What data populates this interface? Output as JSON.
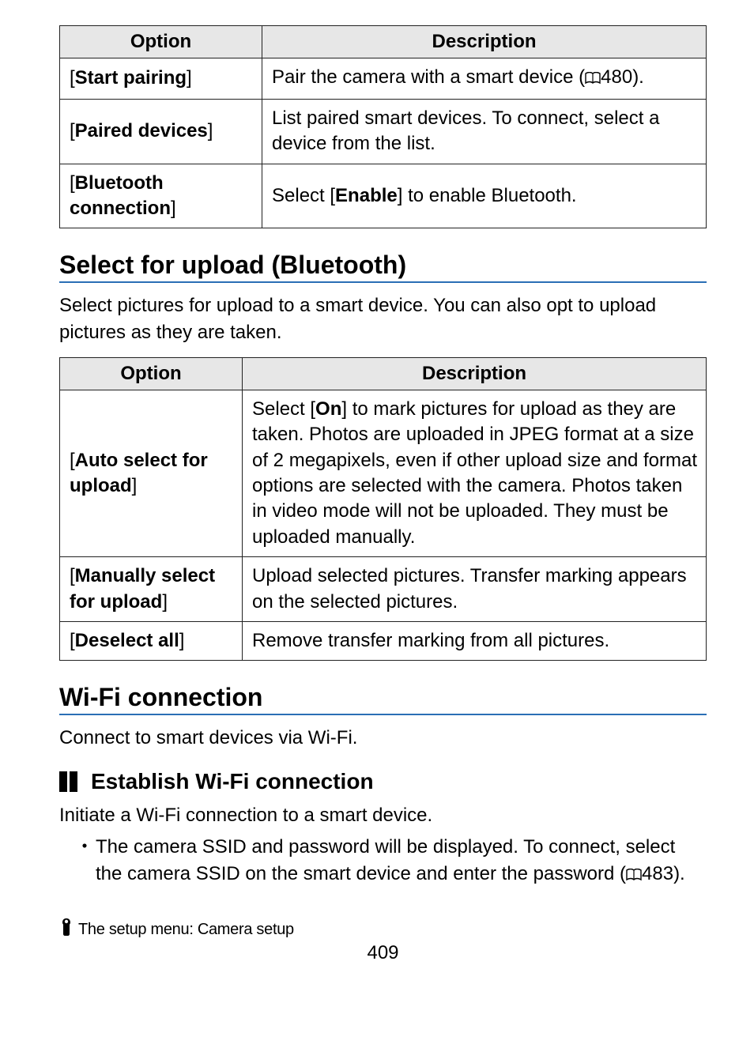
{
  "table1": {
    "headers": {
      "option": "Option",
      "description": "Description"
    },
    "rows": [
      {
        "option_open": "[",
        "option_bold": "Start pairing",
        "option_close": "]",
        "desc_pre": "Pair the camera with a smart device (",
        "desc_ref": "480",
        "desc_post": ")."
      },
      {
        "option_open": "[",
        "option_bold": "Paired devices",
        "option_close": "]",
        "desc": "List paired smart devices. To connect, select a device from the list."
      },
      {
        "option_open": "[",
        "option_bold": "Bluetooth connection",
        "option_close": "]",
        "desc_pre": "Select [",
        "desc_bold": "Enable",
        "desc_post": "] to enable Bluetooth."
      }
    ]
  },
  "section1": {
    "title": "Select for upload (Bluetooth)",
    "lead": "Select pictures for upload to a smart device. You can also opt to upload pictures as they are taken."
  },
  "table2": {
    "headers": {
      "option": "Option",
      "description": "Description"
    },
    "rows": [
      {
        "option_open": "[",
        "option_bold": "Auto select for upload",
        "option_close": "]",
        "desc_pre": "Select [",
        "desc_bold": "On",
        "desc_post": "] to mark pictures for upload as they are taken. Photos are uploaded in JPEG format at a size of 2 megapixels, even if other upload size and format options are selected with the camera. Photos taken in video mode will not be uploaded. They must be uploaded manually."
      },
      {
        "option_open": "[",
        "option_bold": "Manually select for upload",
        "option_close": "]",
        "desc": "Upload selected pictures. Transfer marking appears on the selected pictures."
      },
      {
        "option_open": "[",
        "option_bold": "Deselect all",
        "option_close": "]",
        "desc": "Remove transfer marking from all pictures."
      }
    ]
  },
  "section2": {
    "title": "Wi-Fi connection",
    "lead": "Connect to smart devices via Wi-Fi."
  },
  "sub1": {
    "title": "Establish Wi-Fi connection",
    "lead": "Initiate a Wi-Fi connection to a smart device.",
    "bullet1_pre": "The camera SSID and password will be displayed. To connect, select the camera SSID on the smart device and enter the password (",
    "bullet1_ref": "483",
    "bullet1_post": ")."
  },
  "footer": {
    "label": "The setup menu: Camera setup",
    "pagenum": "409"
  }
}
